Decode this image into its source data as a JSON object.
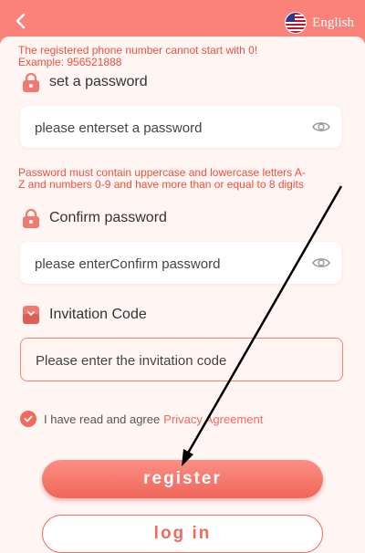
{
  "header": {
    "back_icon": "chevron-left-icon",
    "language": {
      "label": "English",
      "flag_icon": "us-flag-icon"
    }
  },
  "colors": {
    "accent": "#fa8278",
    "error": "#f24f3f",
    "link": "#f26a5c"
  },
  "phone": {
    "hint": "The registered phone number cannot start with 0! Example: 956521888"
  },
  "password": {
    "label": "set a password",
    "placeholder": "please enterset a password",
    "hint": "Password must contain uppercase and lowercase letters A-Z and numbers 0-9 and have more than or equal to 8 digits"
  },
  "confirm": {
    "label": "Confirm password",
    "placeholder": "please enterConfirm password"
  },
  "invitation": {
    "label": "Invitation Code",
    "placeholder": "Please enter the invitation code"
  },
  "agreement": {
    "checked": true,
    "text": "I have read and agree",
    "link": "Privacy Agreement"
  },
  "buttons": {
    "register": "register",
    "login": "log in"
  }
}
